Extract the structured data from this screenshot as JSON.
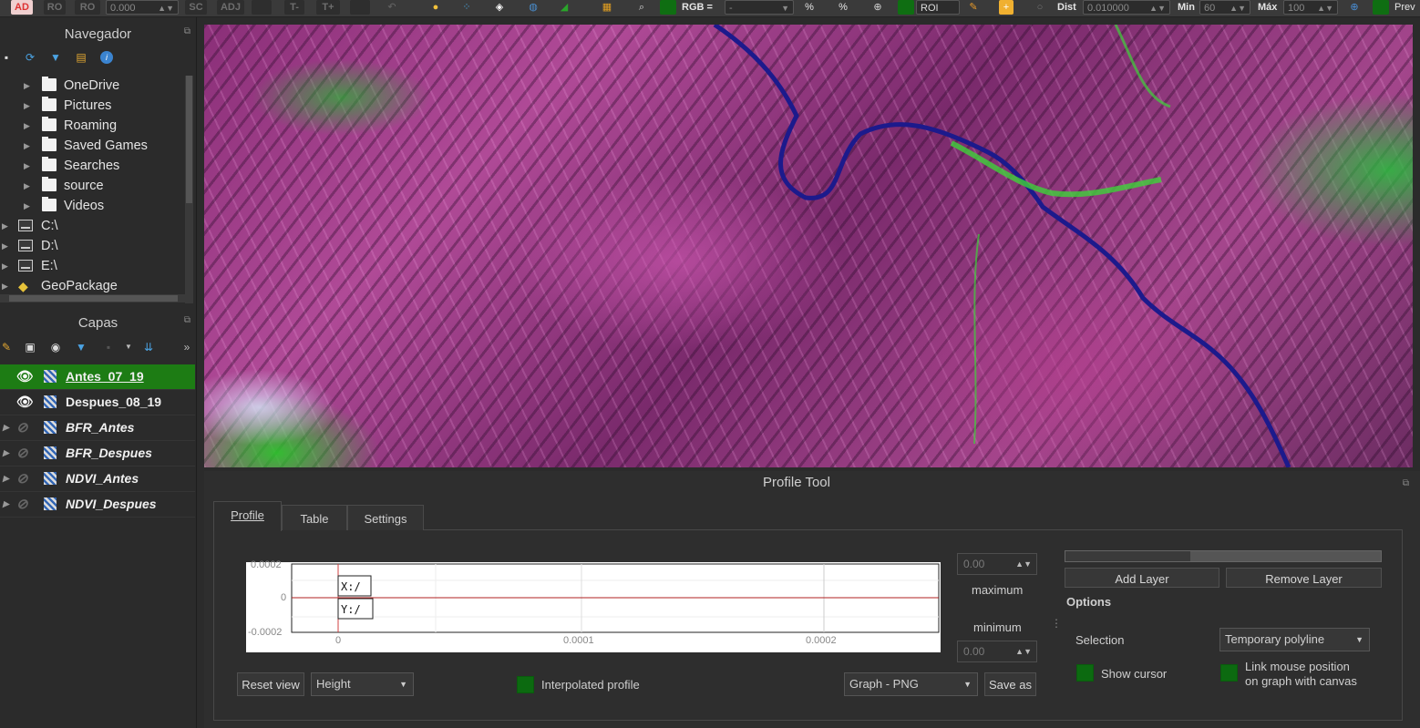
{
  "toolbar": {
    "items": [
      {
        "name": "ad",
        "label": "AD"
      },
      {
        "name": "ro0",
        "label": "RO"
      },
      {
        "name": "ro",
        "label": "RO"
      },
      {
        "name": "value",
        "label": "0.000"
      },
      {
        "name": "sc",
        "label": "SC"
      },
      {
        "name": "adj",
        "label": "ADJ"
      },
      {
        "name": "tminus",
        "label": "T-"
      },
      {
        "name": "tplus",
        "label": "T+"
      }
    ],
    "rgb_label": "RGB =",
    "rgb_value": "-",
    "roi_label": "ROI",
    "dist_label": "Dist",
    "dist_value": "0.010000",
    "min_label": "Min",
    "min_value": "60",
    "max_label": "Máx",
    "max_value": "100",
    "prev_label": "Prev"
  },
  "navigator": {
    "title": "Navegador",
    "items": [
      {
        "label": "OneDrive"
      },
      {
        "label": "Pictures"
      },
      {
        "label": "Roaming"
      },
      {
        "label": "Saved Games"
      },
      {
        "label": "Searches"
      },
      {
        "label": "source"
      },
      {
        "label": "Videos"
      },
      {
        "label": "C:\\"
      },
      {
        "label": "D:\\"
      },
      {
        "label": "E:\\"
      },
      {
        "label": "GeoPackage"
      }
    ]
  },
  "layers": {
    "title": "Capas",
    "items": [
      {
        "label": "Antes_07_19",
        "visible": true,
        "selected": true
      },
      {
        "label": "Despues_08_19",
        "visible": true,
        "selected": false
      },
      {
        "label": "BFR_Antes",
        "visible": false,
        "selected": false
      },
      {
        "label": "BFR_Despues",
        "visible": false,
        "selected": false
      },
      {
        "label": "NDVI_Antes",
        "visible": false,
        "selected": false
      },
      {
        "label": "NDVI_Despues",
        "visible": false,
        "selected": false
      }
    ]
  },
  "profile_tool": {
    "title": "Profile Tool",
    "tabs": [
      "Profile",
      "Table",
      "Settings"
    ],
    "graph": {
      "y_ticks": [
        "0.0002",
        "0",
        "-0.0002"
      ],
      "x_ticks": [
        "0",
        "0.0001",
        "0.0002"
      ],
      "x_readout": "X:/",
      "y_readout": "Y:/"
    },
    "max_value": "0.00",
    "max_label": "maximum",
    "min_label": "minimum",
    "min_value": "0.00",
    "reset_view": "Reset view",
    "height_combo": "Height",
    "interpolated_label": "Interpolated profile",
    "export_combo": "Graph - PNG",
    "save_as": "Save as",
    "add_layer": "Add Layer",
    "remove_layer": "Remove Layer",
    "options_title": "Options",
    "selection_label": "Selection",
    "selection_value": "Temporary polyline",
    "show_cursor": "Show cursor",
    "link_mouse_1": "Link mouse position",
    "link_mouse_2": "on graph with canvas"
  },
  "colors": {
    "accent_green": "#1d7c14",
    "check_green": "#0c6a10",
    "river_blue": "#1c1a8c"
  }
}
